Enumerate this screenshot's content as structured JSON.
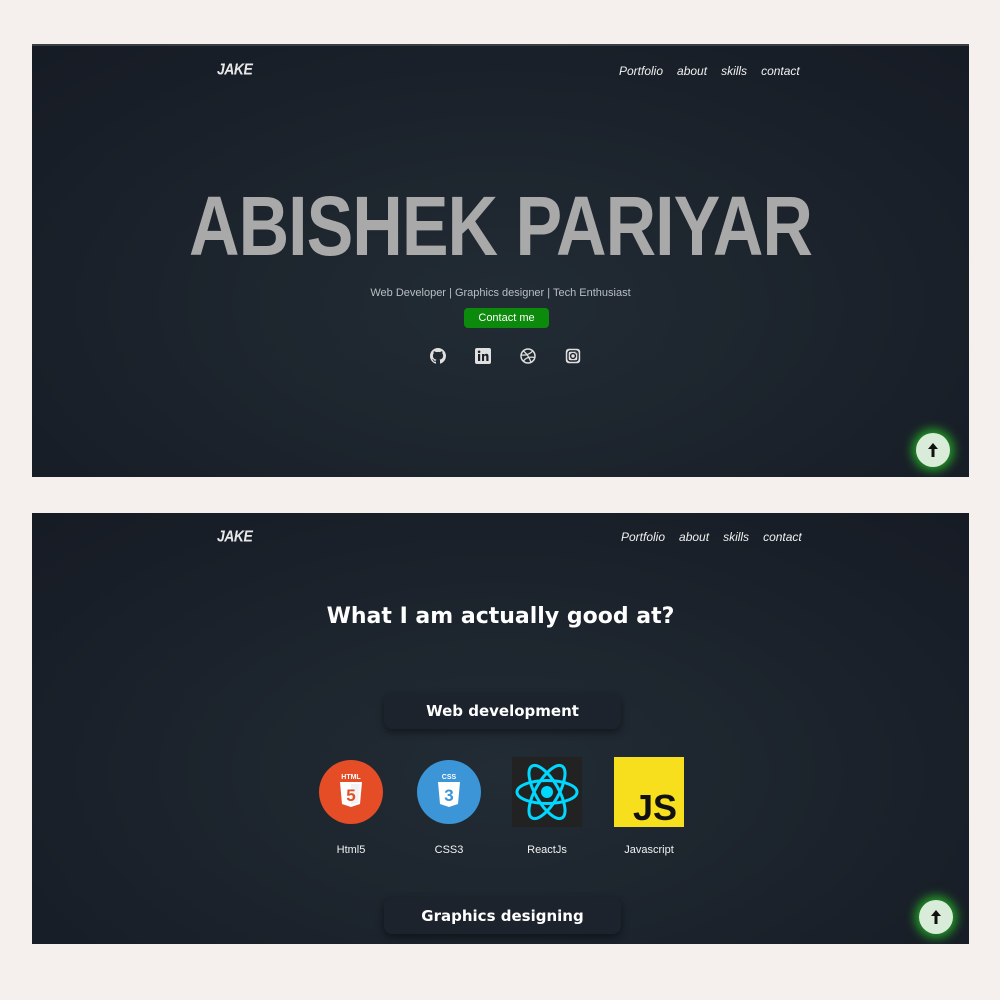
{
  "hero_screen": {
    "logo": "JAKE",
    "nav": [
      "Portfolio",
      "about",
      "skills",
      "contact"
    ],
    "name": "ABISHEK PARIYAR",
    "subtitle": "Web Developer | Graphics designer | Tech Enthusiast",
    "cta_label": "Contact me",
    "socials": [
      "github-icon",
      "linkedin-icon",
      "dribbble-icon",
      "instagram-icon"
    ],
    "scroll_top_icon": "arrow-up-icon"
  },
  "skills_screen": {
    "logo": "JAKE",
    "nav": [
      "Portfolio",
      "about",
      "skills",
      "contact"
    ],
    "title": "What I am actually good at?",
    "categories": [
      "Web development",
      "Graphics designing"
    ],
    "skills": [
      {
        "label": "Html5",
        "icon": "html5-icon",
        "color": "#e44d26"
      },
      {
        "label": "CSS3",
        "icon": "css3-icon",
        "color": "#3b95d6"
      },
      {
        "label": "ReactJs",
        "icon": "react-icon",
        "color": "#00d8ff"
      },
      {
        "label": "Javascript",
        "icon": "javascript-icon",
        "color": "#f7df1e"
      }
    ],
    "scroll_top_icon": "arrow-up-icon"
  },
  "colors": {
    "background": "#f5f0ed",
    "panel": "#1b222b",
    "name_text": "#a9a9a9",
    "cta": "#0c8a0c",
    "glow": "#28c828"
  }
}
